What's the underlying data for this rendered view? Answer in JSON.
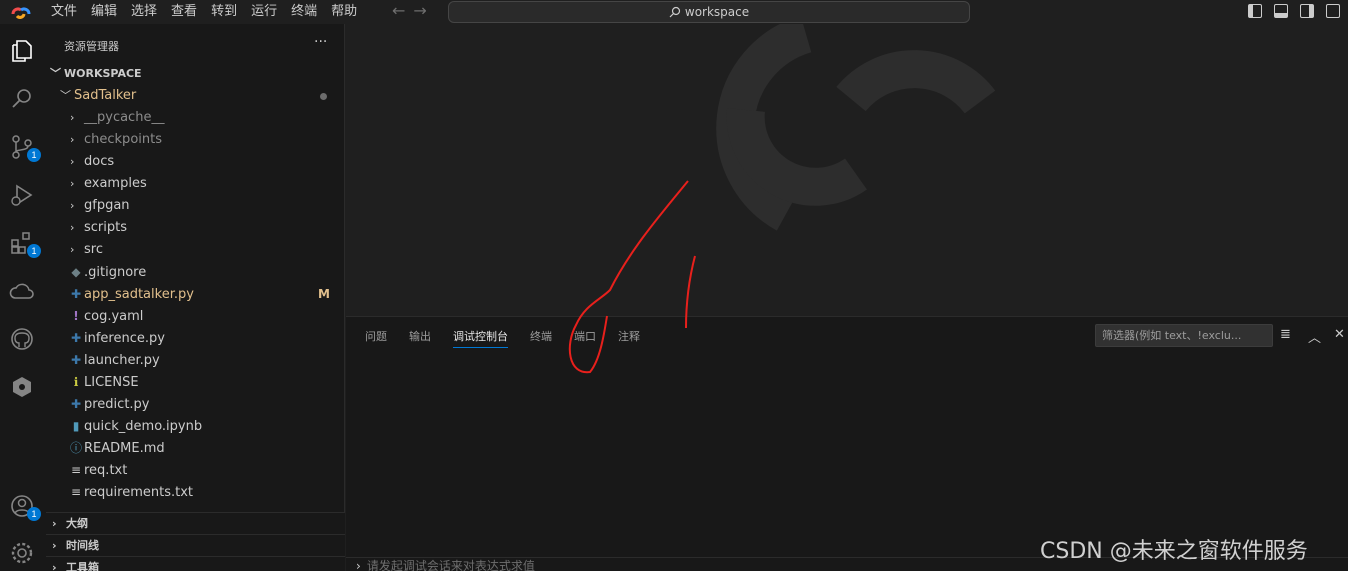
{
  "menu": [
    "文件",
    "编辑",
    "选择",
    "查看",
    "转到",
    "运行",
    "终端",
    "帮助"
  ],
  "search": {
    "text": "workspace"
  },
  "activity": {
    "badges": {
      "source_control": "1",
      "extensions": "1",
      "accounts": "1"
    }
  },
  "sidebar": {
    "title": "资源管理器",
    "more": "···",
    "workspace": "WORKSPACE",
    "folder": "SadTalker",
    "items": [
      {
        "label": "__pycache__",
        "kind": "folder"
      },
      {
        "label": "checkpoints",
        "kind": "folder"
      },
      {
        "label": "docs",
        "kind": "folder"
      },
      {
        "label": "examples",
        "kind": "folder"
      },
      {
        "label": "gfpgan",
        "kind": "folder"
      },
      {
        "label": "scripts",
        "kind": "folder"
      },
      {
        "label": "src",
        "kind": "folder"
      },
      {
        "label": ".gitignore",
        "kind": "file"
      },
      {
        "label": "app_sadtalker.py",
        "kind": "file",
        "flag": "M"
      },
      {
        "label": "cog.yaml",
        "kind": "file"
      },
      {
        "label": "inference.py",
        "kind": "file"
      },
      {
        "label": "launcher.py",
        "kind": "file"
      },
      {
        "label": "LICENSE",
        "kind": "file"
      },
      {
        "label": "predict.py",
        "kind": "file"
      },
      {
        "label": "quick_demo.ipynb",
        "kind": "file"
      },
      {
        "label": "README.md",
        "kind": "file"
      },
      {
        "label": "req.txt",
        "kind": "file"
      },
      {
        "label": "requirements.txt",
        "kind": "file"
      }
    ],
    "sections": [
      "大纲",
      "时间线",
      "工具箱"
    ]
  },
  "panel": {
    "tabs": [
      "问题",
      "输出",
      "调试控制台",
      "终端",
      "端口",
      "注释"
    ],
    "active_tab": "调试控制台",
    "filter_placeholder": "筛选器(例如 text、!exclu...",
    "console_placeholder": "请发起调试会话来对表达式求值"
  },
  "watermark": "CSDN @未来之窗软件服务",
  "colors": {
    "accent": "#0078d4",
    "modified": "#e2c08d",
    "annotation": "#e8201c"
  }
}
